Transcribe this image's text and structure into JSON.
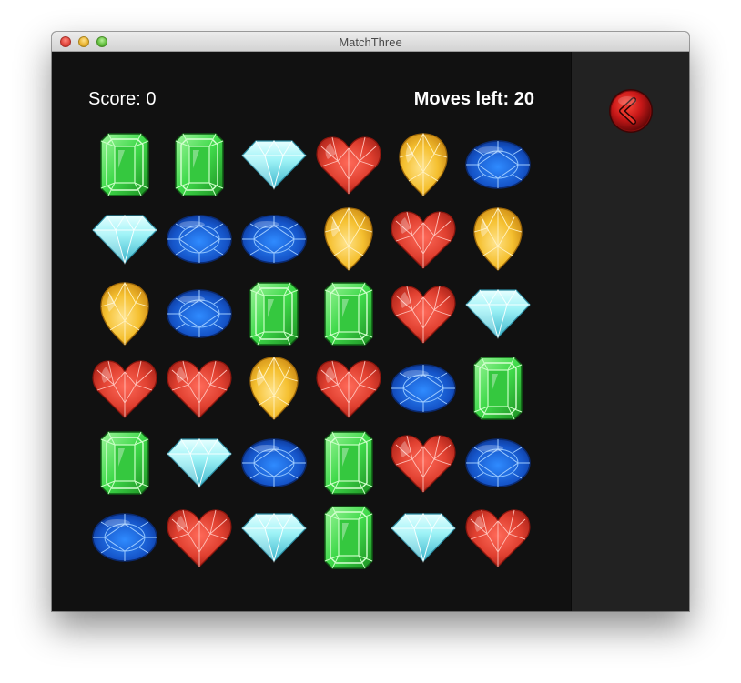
{
  "window": {
    "title": "MatchThree"
  },
  "hud": {
    "score_label": "Score: 0",
    "moves_label": "Moves left: 20"
  },
  "colors": {
    "window_bg": "#111111",
    "side_panel_bg": "#222222",
    "green": "#3fd94a",
    "blue": "#1f6fe0",
    "diamond": "#9ff3f7",
    "ruby": "#e04030",
    "amber": "#f5c030",
    "back_button": "#c81818"
  },
  "board": {
    "rows": [
      [
        "emerald",
        "emerald",
        "diamond",
        "heart",
        "teardrop",
        "oval"
      ],
      [
        "diamond",
        "oval",
        "oval",
        "teardrop",
        "heart",
        "teardrop"
      ],
      [
        "teardrop",
        "oval",
        "emerald",
        "emerald",
        "heart",
        "diamond"
      ],
      [
        "heart",
        "heart",
        "teardrop",
        "heart",
        "oval",
        "emerald"
      ],
      [
        "emerald",
        "diamond",
        "oval",
        "emerald",
        "heart",
        "oval"
      ],
      [
        "oval",
        "heart",
        "diamond",
        "emerald",
        "diamond",
        "heart"
      ]
    ]
  },
  "side_panel": {
    "back_icon": "back-arrow-icon"
  }
}
